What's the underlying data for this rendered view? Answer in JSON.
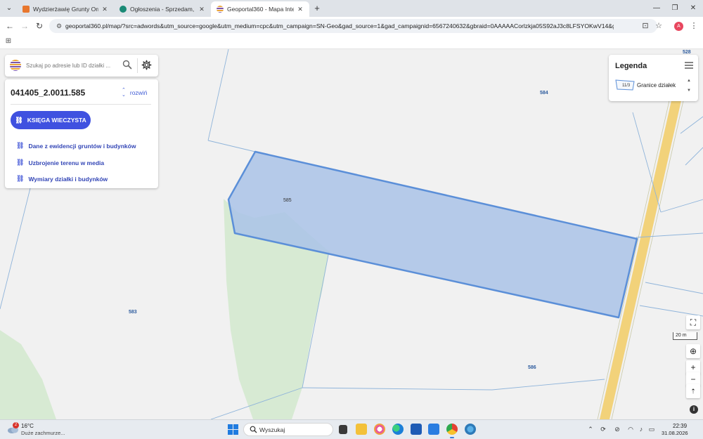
{
  "browser": {
    "tabs": [
      {
        "title": "Wydzierżawię Grunty Orne - N",
        "favicon_color": "#e8772e",
        "active": false
      },
      {
        "title": "Ogłoszenia - Sprzedam, kupię",
        "favicon_color": "#1a8a76",
        "active": false
      },
      {
        "title": "Geoportal360 - Mapa Interakt",
        "favicon_color": "#e9a43a",
        "active": true
      }
    ],
    "url": "geoportal360.pl/map/?src=adwords&utm_source=google&utm_medium=cpc&utm_campaign=SN-Geo&gad_source=1&gad_campaignid=6567240632&gbraid=0AAAAACorlzkja05S92aJ3c8LFSYOKwV14&gclid=CjwKCAjwz...",
    "profile_initial": "A"
  },
  "search": {
    "placeholder": "Szukaj po adresie lub ID działki ..."
  },
  "parcel_panel": {
    "parcel_id": "041405_2.0011.585",
    "expand_label": "rozwiń",
    "kw_button": "KSIĘGA WIECZYSTA",
    "links": [
      "Dane z ewidencji gruntów i budynków",
      "Uzbrojenie terenu w media",
      "Wymiary działki i budynków"
    ]
  },
  "legend": {
    "title": "Legenda",
    "item_label": "Granice działek",
    "item_icon_text": "11/3"
  },
  "map": {
    "parcel_labels": [
      "528",
      "584",
      "585",
      "583",
      "586"
    ],
    "scale_label": "20 m",
    "colors": {
      "selected_fill": "#aac3e8",
      "selected_stroke": "#5b8fd8",
      "forest": "#d7ead3",
      "road": "#f2d27a"
    }
  },
  "taskbar": {
    "weather_badge": "2",
    "temperature": "16°C",
    "weather_desc": "Duże zachmurze...",
    "search_label": "Wyszukaj",
    "time": "22:39",
    "date": "31.08.2026"
  }
}
